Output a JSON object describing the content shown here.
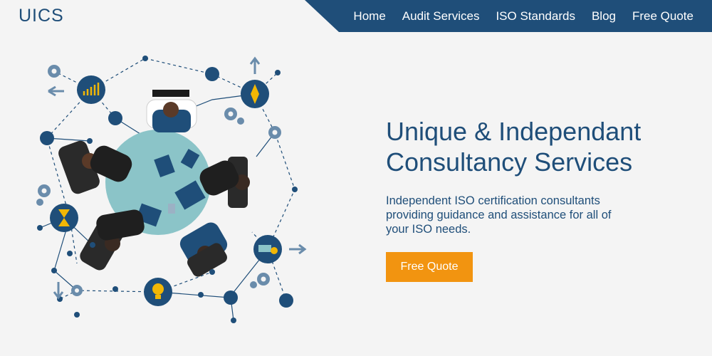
{
  "brand": {
    "logo_text": "UICS"
  },
  "nav": {
    "items": [
      {
        "label": "Home"
      },
      {
        "label": "Audit Services"
      },
      {
        "label": "ISO Standards"
      },
      {
        "label": "Blog"
      },
      {
        "label": "Free Quote"
      }
    ]
  },
  "hero": {
    "title_line1": "Unique & Independant",
    "title_line2": "Consultancy Services",
    "subtitle_line1": "Independent ISO certification consultants",
    "subtitle_line2": "providing guidance and assistance for all of",
    "subtitle_line3": "your ISO needs.",
    "cta_label": "Free Quote"
  },
  "colors": {
    "brand_navy": "#1f4e79",
    "accent_orange": "#f29410",
    "table_teal": "#8bc4c8",
    "background": "#f4f4f4"
  }
}
